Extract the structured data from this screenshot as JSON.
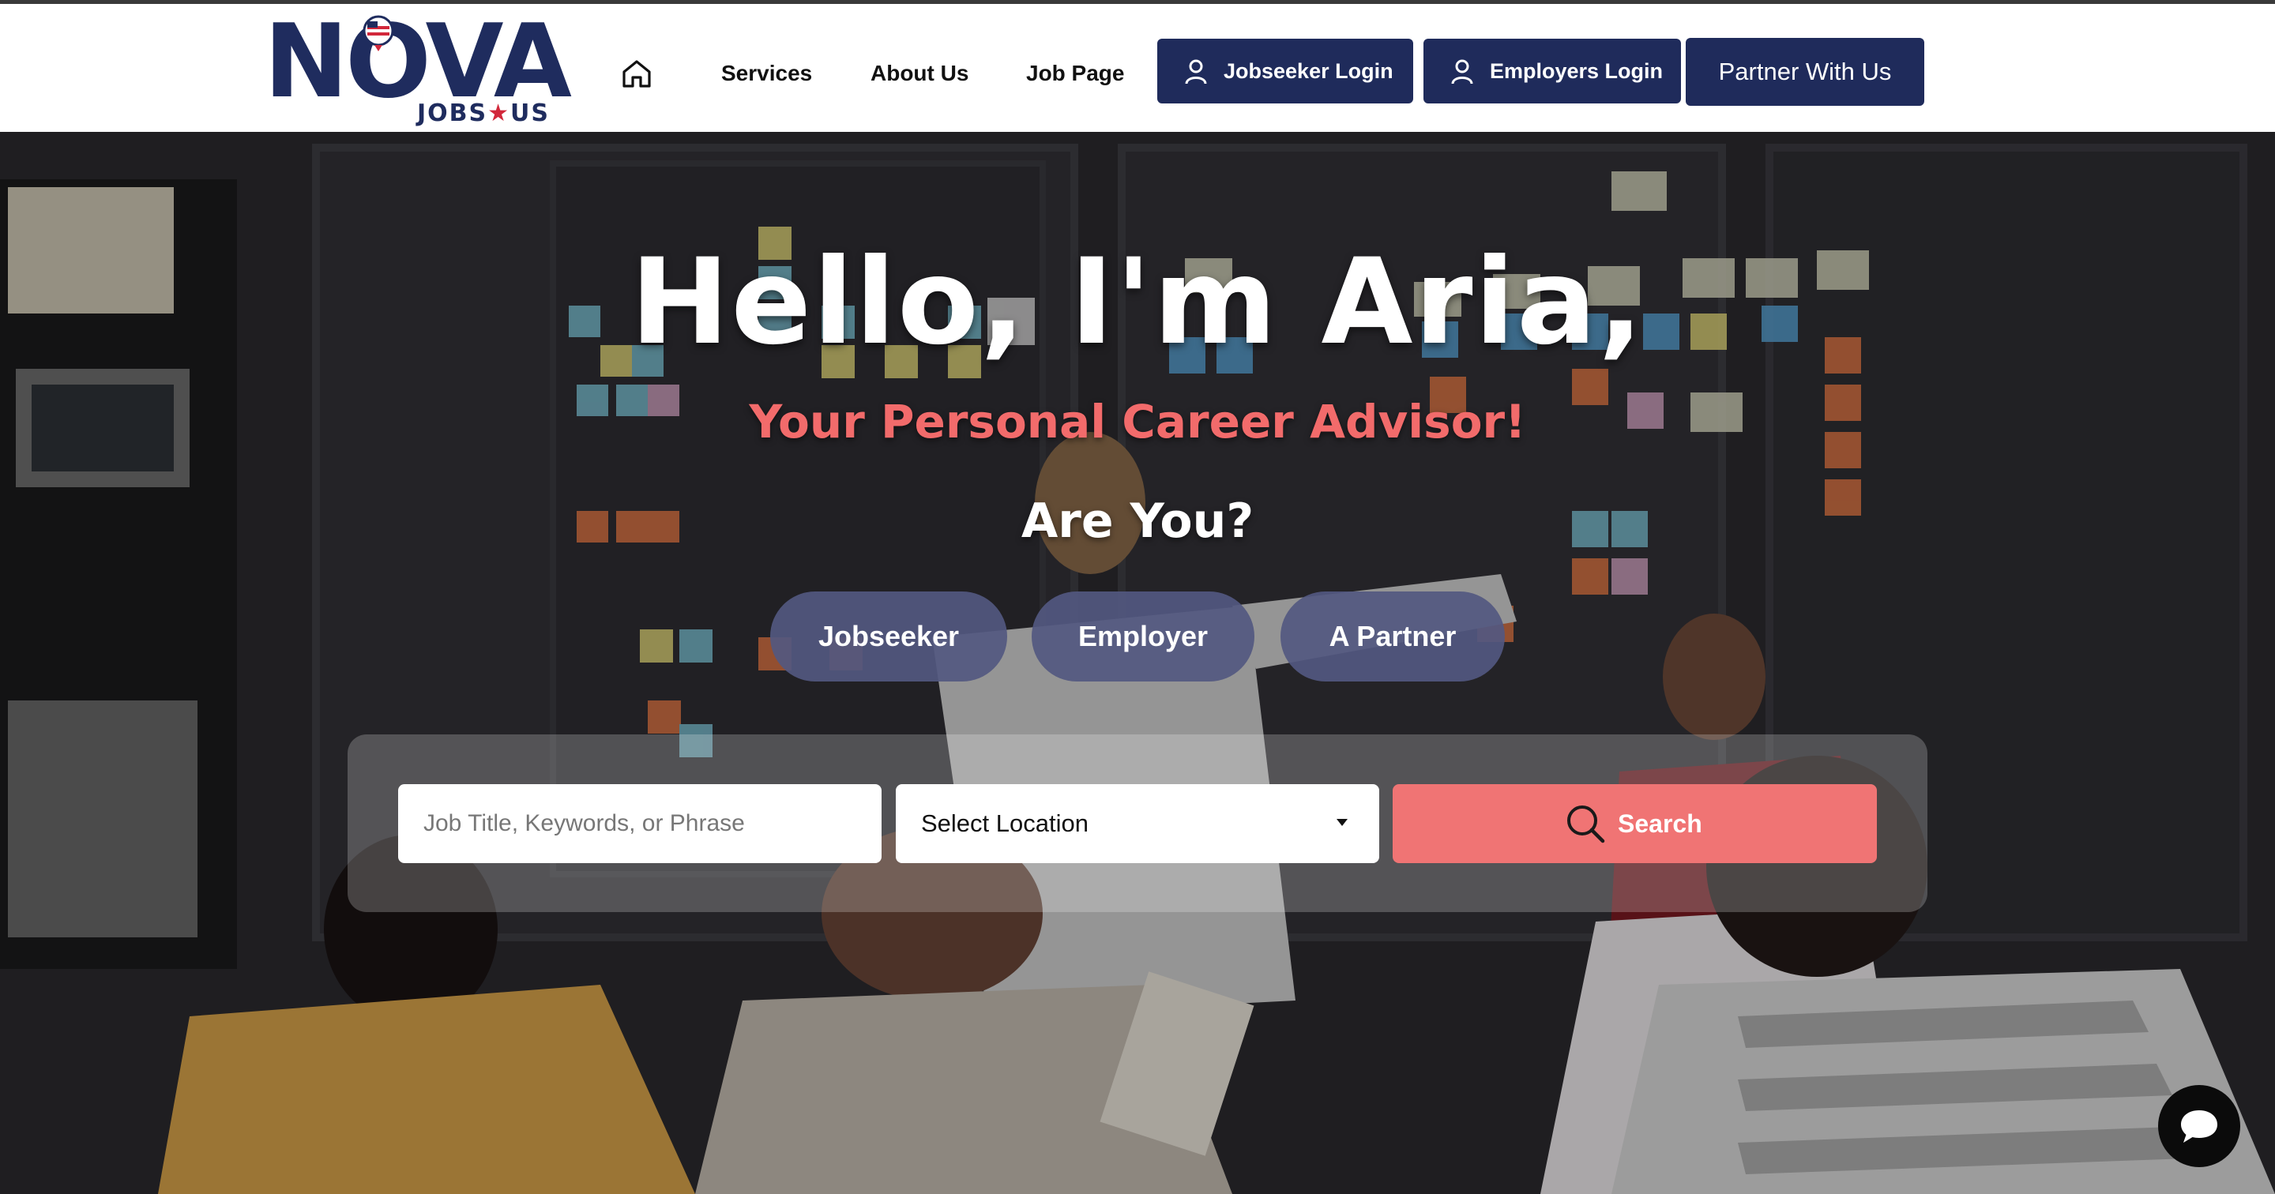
{
  "brand": {
    "name": "NOVA",
    "tagline_left": "JOBS",
    "tagline_star": "★",
    "tagline_right": "US"
  },
  "nav": {
    "home_icon": "home-icon",
    "services": "Services",
    "about": "About Us",
    "job_page": "Job Page"
  },
  "header_buttons": {
    "jobseeker_login": "Jobseeker Login",
    "employers_login": "Employers Login",
    "partner": "Partner With Us",
    "user_icon": "user-icon"
  },
  "hero": {
    "title": "Hello, I'm Aria,",
    "subtitle": "Your Personal Career Advisor!",
    "question": "Are You?",
    "roles": [
      "Jobseeker",
      "Employer",
      "A Partner"
    ]
  },
  "search": {
    "keyword_placeholder": "Job Title, Keywords, or Phrase",
    "keyword_value": "",
    "location_selected": "Select Location",
    "button_label": "Search",
    "button_icon": "search-icon"
  },
  "chat": {
    "icon": "chat-icon"
  },
  "colors": {
    "navy": "#1f2b5b",
    "brand_red": "#d2283b",
    "accent_coral": "#f07474",
    "subtitle_coral": "#f26b6b",
    "role_button": "#525880"
  }
}
